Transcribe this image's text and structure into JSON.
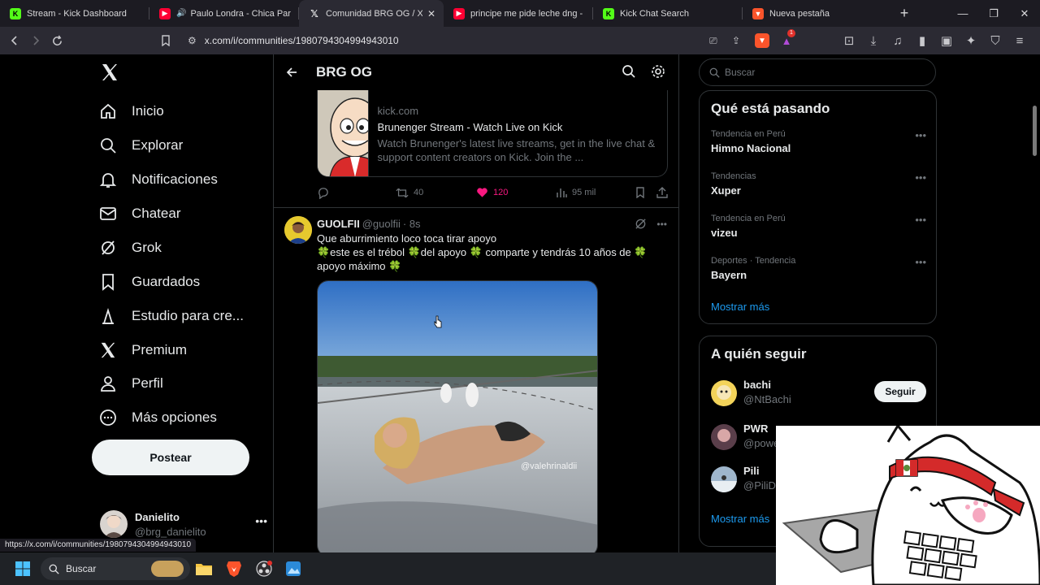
{
  "browser": {
    "tabs": [
      {
        "title": "Stream - Kick Dashboard",
        "icon": "kick-icon",
        "color": "#53fc18"
      },
      {
        "title": "Paulo Londra - Chica Paranormal",
        "icon": "youtube-icon",
        "color": "#ff0033",
        "audio": true
      },
      {
        "title": "Comunidad BRG OG / X",
        "icon": "x-icon",
        "color": "#ffffff",
        "active": true
      },
      {
        "title": "principe me pide leche dng - YouTube",
        "icon": "youtube-icon",
        "color": "#ff0033"
      },
      {
        "title": "Kick Chat Search",
        "icon": "kick-icon",
        "color": "#53fc18"
      },
      {
        "title": "Nueva pestaña",
        "icon": "brave-icon",
        "color": "#fb542b"
      }
    ],
    "url": "x.com/i/communities/1980794304994943010",
    "status_url": "https://x.com/i/communities/1980794304994943010",
    "brave_badge": "1"
  },
  "nav": {
    "items": [
      {
        "label": "Inicio",
        "icon": "home-icon"
      },
      {
        "label": "Explorar",
        "icon": "search-icon"
      },
      {
        "label": "Notificaciones",
        "icon": "bell-icon"
      },
      {
        "label": "Chatear",
        "icon": "mail-icon"
      },
      {
        "label": "Grok",
        "icon": "grok-icon"
      },
      {
        "label": "Guardados",
        "icon": "bookmark-icon"
      },
      {
        "label": "Estudio para cre...",
        "icon": "creator-studio-icon"
      },
      {
        "label": "Premium",
        "icon": "x-premium-icon"
      },
      {
        "label": "Perfil",
        "icon": "person-icon"
      },
      {
        "label": "Más opciones",
        "icon": "more-circle-icon"
      }
    ],
    "post_label": "Postear",
    "user": {
      "name": "Danielito",
      "handle": "@brg_danielito"
    }
  },
  "community": {
    "title": "BRG OG"
  },
  "link_card": {
    "domain": "kick.com",
    "title": "Brunenger Stream - Watch Live on Kick",
    "description": "Watch Brunenger's latest live streams, get in the live chat & support content creators on Kick. Join the ..."
  },
  "tweet1_actions": {
    "retweets": "40",
    "likes": "120",
    "views": "95 mil",
    "like_color": "#f91880"
  },
  "tweet2": {
    "name": "GUOLFII",
    "handle": "@guolfii",
    "time": "· 8s",
    "line1": "Que aburrimiento loco toca tirar apoyo",
    "line2": "🍀este es el trébol 🍀del apoyo 🍀 comparte y tendrás 10 años de 🍀 apoyo máximo 🍀",
    "watermark": "@valehrinaldii"
  },
  "right": {
    "search_placeholder": "Buscar",
    "trends_title": "Qué está pasando",
    "trends": [
      {
        "context": "Tendencia en Perú",
        "topic": "Himno Nacional"
      },
      {
        "context": "Tendencias",
        "topic": "Xuper"
      },
      {
        "context": "Tendencia en Perú",
        "topic": "vizeu"
      },
      {
        "context": "Deportes · Tendencia",
        "topic": "Bayern"
      }
    ],
    "trends_more": "Mostrar más",
    "follow_title": "A quién seguir",
    "follow": [
      {
        "name": "bachi",
        "handle": "@NtBachi"
      },
      {
        "name": "PWR",
        "handle": "@powe"
      },
      {
        "name": "Pili",
        "handle": "@PiliDi"
      }
    ],
    "follow_button": "Seguir",
    "follow_more": "Mostrar más"
  },
  "taskbar": {
    "search_label": "Buscar"
  },
  "colors": {
    "accent": "#1d9bf0",
    "background": "#000000",
    "border": "#2f3336"
  }
}
